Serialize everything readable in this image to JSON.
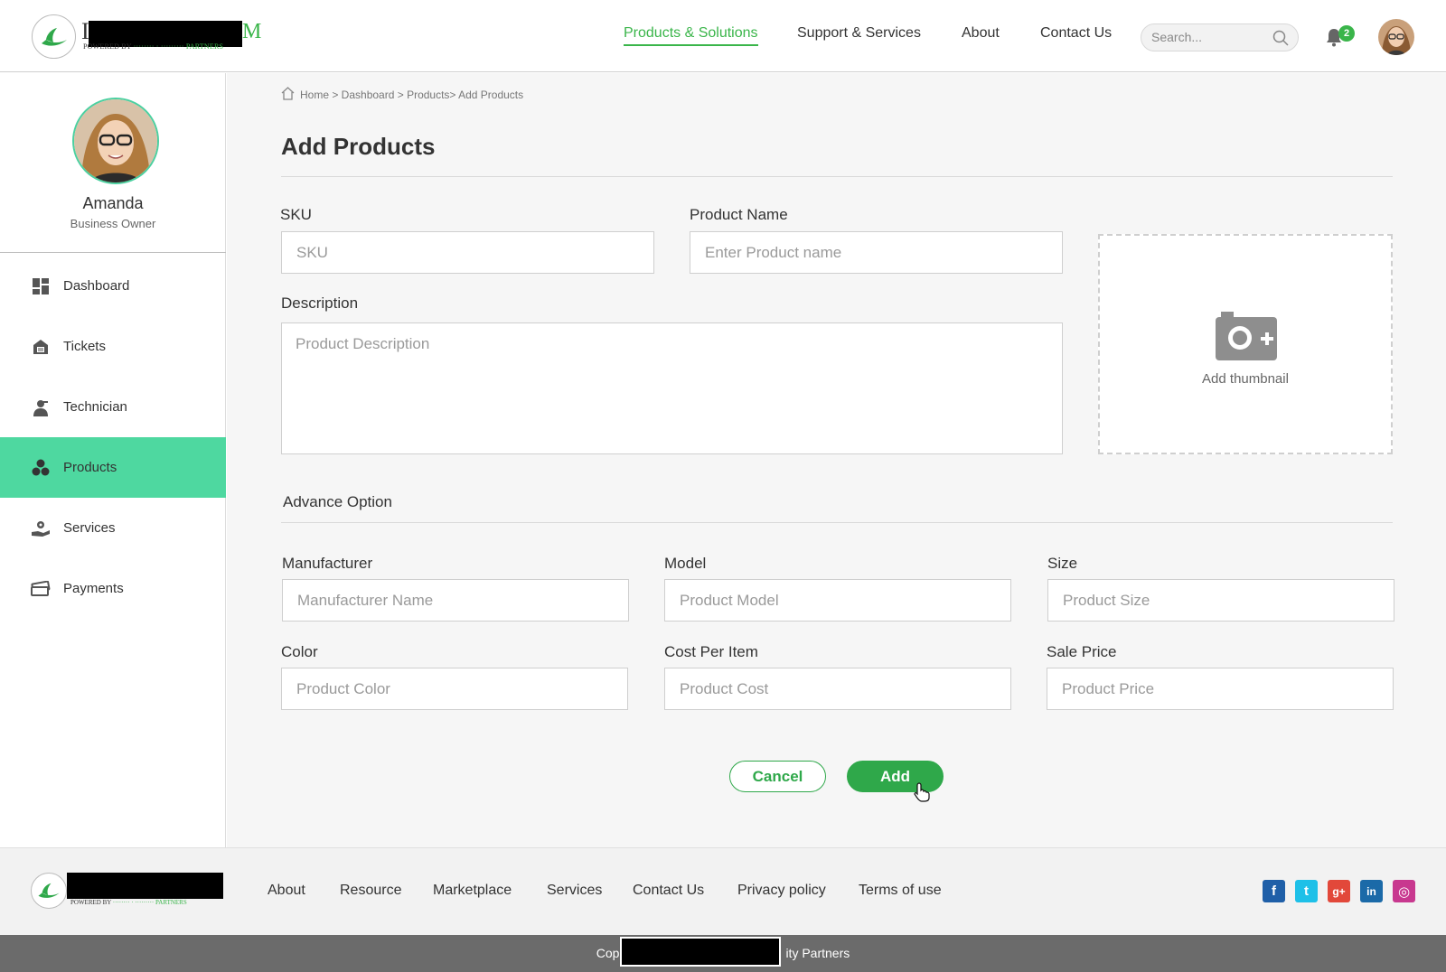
{
  "header": {
    "logo": {
      "letter_left": "I",
      "letter_right": "M",
      "tagline_prefix": "POWERED BY",
      "tagline_partners": "PARTNERS"
    },
    "nav": [
      {
        "label": "Products & Solutions",
        "active": true
      },
      {
        "label": "Support & Services",
        "active": false
      },
      {
        "label": "About",
        "active": false
      },
      {
        "label": "Contact Us",
        "active": false
      }
    ],
    "search": {
      "placeholder": "Search..."
    },
    "notifications": {
      "count": "2"
    },
    "accent_color": "#3ab54a"
  },
  "sidebar": {
    "profile": {
      "name": "Amanda",
      "role": "Business Owner"
    },
    "items": [
      {
        "label": "Dashboard",
        "icon": "dashboard-icon",
        "active": false
      },
      {
        "label": "Tickets",
        "icon": "tickets-icon",
        "active": false
      },
      {
        "label": "Technician",
        "icon": "technician-icon",
        "active": false
      },
      {
        "label": "Products",
        "icon": "products-icon",
        "active": true
      },
      {
        "label": "Services",
        "icon": "services-icon",
        "active": false
      },
      {
        "label": "Payments",
        "icon": "payments-icon",
        "active": false
      }
    ],
    "active_color": "#4ed8a0"
  },
  "main": {
    "breadcrumb": "Home > Dashboard > Products> Add Products",
    "title": "Add Products",
    "form": {
      "sku": {
        "label": "SKU",
        "placeholder": "SKU",
        "value": ""
      },
      "product_name": {
        "label": "Product Name",
        "placeholder": "Enter Product name",
        "value": ""
      },
      "description": {
        "label": "Description",
        "placeholder": "Product Description",
        "value": ""
      },
      "thumbnail": {
        "label": "Add thumbnail"
      },
      "advance_title": "Advance Option",
      "manufacturer": {
        "label": "Manufacturer",
        "placeholder": "Manufacturer Name",
        "value": ""
      },
      "model": {
        "label": "Model",
        "placeholder": "Product Model",
        "value": ""
      },
      "size": {
        "label": "Size",
        "placeholder": "Product Size",
        "value": ""
      },
      "color": {
        "label": "Color",
        "placeholder": "Product Color",
        "value": ""
      },
      "cost_per_item": {
        "label": "Cost Per Item",
        "placeholder": "Product Cost",
        "value": ""
      },
      "sale_price": {
        "label": "Sale Price",
        "placeholder": "Product Price",
        "value": ""
      }
    },
    "buttons": {
      "cancel": "Cancel",
      "add": "Add"
    },
    "button_color": "#2fa84a"
  },
  "footer": {
    "links": [
      "About",
      "Resource",
      "Marketplace",
      "Services",
      "Contact Us",
      "Privacy policy",
      "Terms of use"
    ],
    "social": [
      {
        "name": "facebook-icon",
        "glyph": "f",
        "color": "#1f5fa8"
      },
      {
        "name": "twitter-icon",
        "glyph": "t",
        "color": "#1ec0e8"
      },
      {
        "name": "google-plus-icon",
        "glyph": "g+",
        "color": "#e2483a"
      },
      {
        "name": "linkedin-icon",
        "glyph": "in",
        "color": "#1b6aa8"
      },
      {
        "name": "instagram-icon",
        "glyph": "◎",
        "color": "#c8388f"
      }
    ],
    "copyright_left": "Cop",
    "copyright_right": "ity Partners"
  }
}
